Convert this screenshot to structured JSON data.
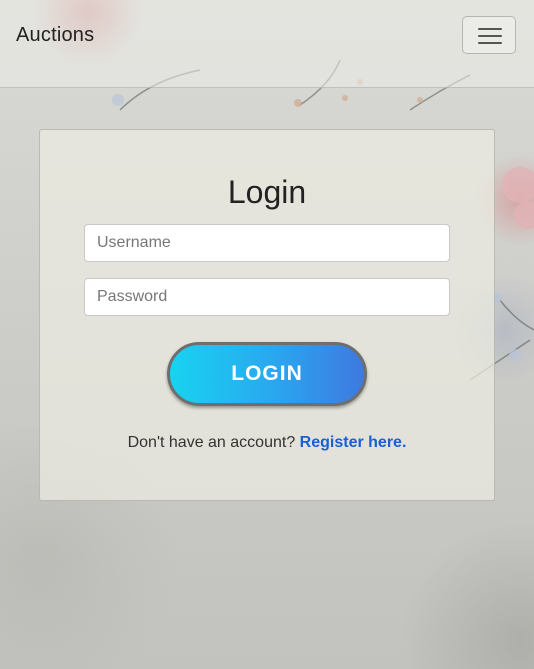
{
  "navbar": {
    "brand": "Auctions",
    "toggle_icon": "hamburger-menu-icon"
  },
  "login": {
    "title": "Login",
    "username_placeholder": "Username",
    "password_placeholder": "Password",
    "button_label": "LOGIN",
    "button_gradient": [
      "#18d3f0",
      "#3f78e0"
    ],
    "register_prompt": "Don't have an account?",
    "register_link": "Register here.",
    "link_color": "#1a5fd6"
  }
}
